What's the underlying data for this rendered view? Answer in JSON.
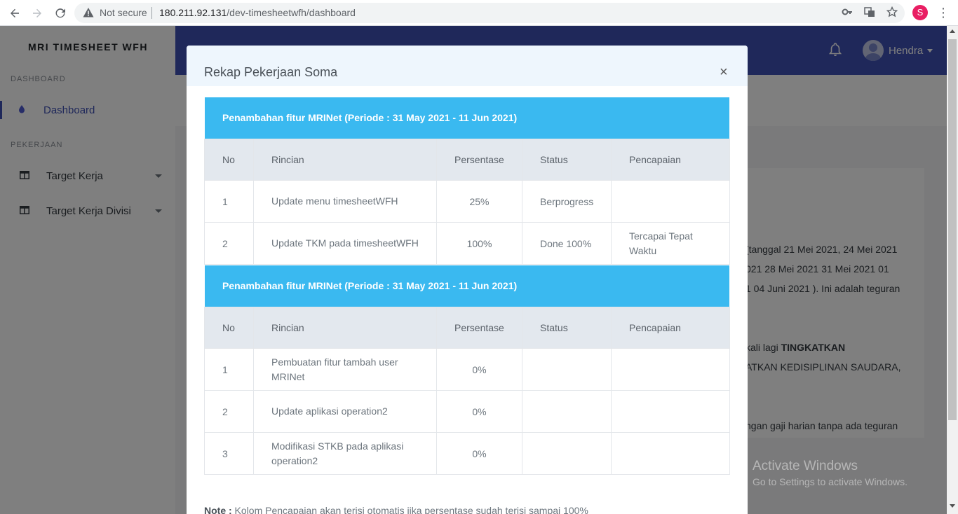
{
  "browser": {
    "security_label": "Not secure",
    "url_host": "180.211.92.131",
    "url_path": "/dev-timesheetwfh/dashboard",
    "profile_initial": "S"
  },
  "sidebar": {
    "brand": "MRI TIMESHEET WFH",
    "sections": [
      {
        "heading": "DASHBOARD",
        "items": [
          {
            "label": "Dashboard",
            "icon": "drop-icon",
            "active": true
          }
        ]
      },
      {
        "heading": "PEKERJAAN",
        "items": [
          {
            "label": "Target Kerja",
            "icon": "table-icon",
            "has_dropdown": true
          },
          {
            "label": "Target Kerja Divisi",
            "icon": "table-icon",
            "has_dropdown": true
          }
        ]
      }
    ]
  },
  "topbar": {
    "user_name": "Hendra"
  },
  "background_card": {
    "lines": [
      "(tanggal 21 Mei 2021, 24 Mei 2021",
      "021 28 Mei 2021 31 Mei 2021 01",
      "1 04 Juni 2021 ). Ini adalah teguran",
      "kali lagi ",
      "TINGKATKAN",
      "ATKAN KEDISIPLINAN SAUDARA,",
      "ngan gaji harian tanpa ada teguran"
    ]
  },
  "watermark": {
    "line1": "Activate Windows",
    "line2": "Go to Settings to activate Windows."
  },
  "modal": {
    "title": "Rekap Pekerjaan Soma",
    "close_symbol": "×",
    "columns": [
      "No",
      "Rincian",
      "Persentase",
      "Status",
      "Pencapaian"
    ],
    "groups": [
      {
        "header": "Penambahan fitur MRINet (Periode : 31 May 2021 - 11 Jun 2021)",
        "rows": [
          {
            "no": "1",
            "rincian": "Update menu timesheetWFH",
            "persentase": "25%",
            "status": "Berprogress",
            "pencapaian": ""
          },
          {
            "no": "2",
            "rincian": "Update TKM pada timesheetWFH",
            "persentase": "100%",
            "status": "Done 100%",
            "pencapaian": "Tercapai Tepat Waktu"
          }
        ]
      },
      {
        "header": "Penambahan fitur MRINet (Periode : 31 May 2021 - 11 Jun 2021)",
        "rows": [
          {
            "no": "1",
            "rincian": "Pembuatan fitur tambah user MRINet",
            "persentase": "0%",
            "status": "",
            "pencapaian": ""
          },
          {
            "no": "2",
            "rincian": "Update aplikasi operation2",
            "persentase": "0%",
            "status": "",
            "pencapaian": ""
          },
          {
            "no": "3",
            "rincian": "Modifikasi STKB pada aplikasi operation2",
            "persentase": "0%",
            "status": "",
            "pencapaian": ""
          }
        ]
      }
    ],
    "note_label": "Note :",
    "note_text": " Kolom Pencapaian akan terisi otomatis jika persentase sudah terisi sampai 100%"
  }
}
